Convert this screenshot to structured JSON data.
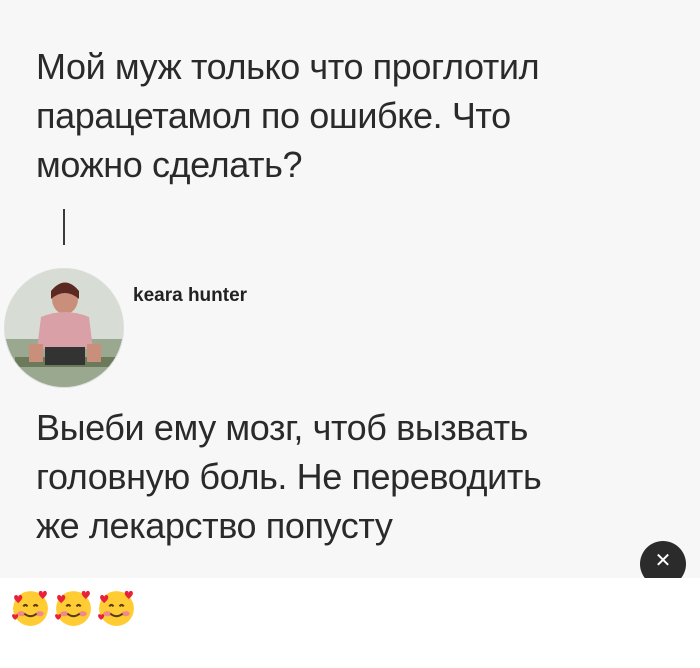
{
  "post": {
    "question": "Мой муж только что проглотил\nпарацетамол по ошибке. Что\nможно сделать?"
  },
  "reply": {
    "username": "keara hunter",
    "text": "Выеби ему мозг, чтоб вызвать\nголовную боль. Не переводить\nже лекарство попусту"
  },
  "overlay": {
    "close_glyph": "✕"
  },
  "reactions": {
    "emoji": [
      "smiling-face-with-hearts",
      "smiling-face-with-hearts",
      "smiling-face-with-hearts"
    ]
  }
}
